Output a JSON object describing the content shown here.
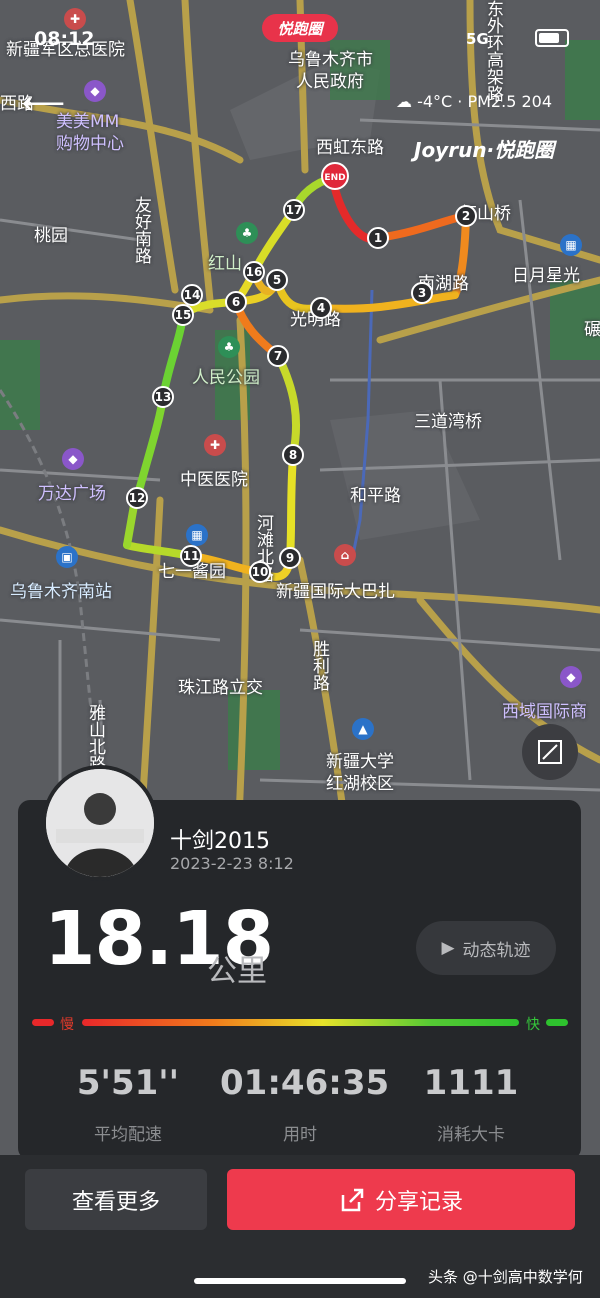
{
  "status": {
    "time": "08:12",
    "network": "5G",
    "brand_pill": "悦跑圈"
  },
  "header": {
    "weather": "-4°C · PM2.5 204",
    "brand": "Joyrun·悦跑圈"
  },
  "map": {
    "labels": [
      "新疆军区总医院",
      "乌鲁木齐市",
      "人民政府",
      "西虹东路",
      "美美MM",
      "购物中心",
      "友好南路",
      "桃园",
      "红山",
      "日月星光",
      "光明路",
      "人民公园",
      "三道湾桥",
      "中医医院",
      "和平路",
      "万达广场",
      "乌鲁木齐南站",
      "七一酱园",
      "河滩北路",
      "新疆国际大巴扎",
      "胜利路",
      "珠江路立交",
      "雅山北路",
      "新疆大学",
      "红湖校区",
      "西域国际商",
      "西路",
      "东外环高架路",
      "碾",
      "红山桥",
      "南湖路"
    ],
    "end_marker": "END",
    "km_markers": [
      "1",
      "2",
      "3",
      "4",
      "5",
      "6",
      "7",
      "8",
      "9",
      "10",
      "11",
      "12",
      "13",
      "14",
      "15",
      "16",
      "17"
    ],
    "colors": {
      "slow": "#e8282a",
      "mid": "#e7e22a",
      "fast": "#2ec22e"
    }
  },
  "record": {
    "user_name": "十剑2015",
    "date": "2023-2-23 8:12",
    "distance": "18.18",
    "distance_unit": "公里",
    "dynamic_track": "动态轨迹",
    "scale_slow": "慢",
    "scale_fast": "快",
    "stats": [
      {
        "value": "5'51''",
        "label": "平均配速"
      },
      {
        "value": "01:46:35",
        "label": "用时"
      },
      {
        "value": "1111",
        "label": "消耗大卡"
      }
    ]
  },
  "actions": {
    "more": "查看更多",
    "share": "分享记录"
  },
  "watermark": "头条 @十剑高中数学何"
}
